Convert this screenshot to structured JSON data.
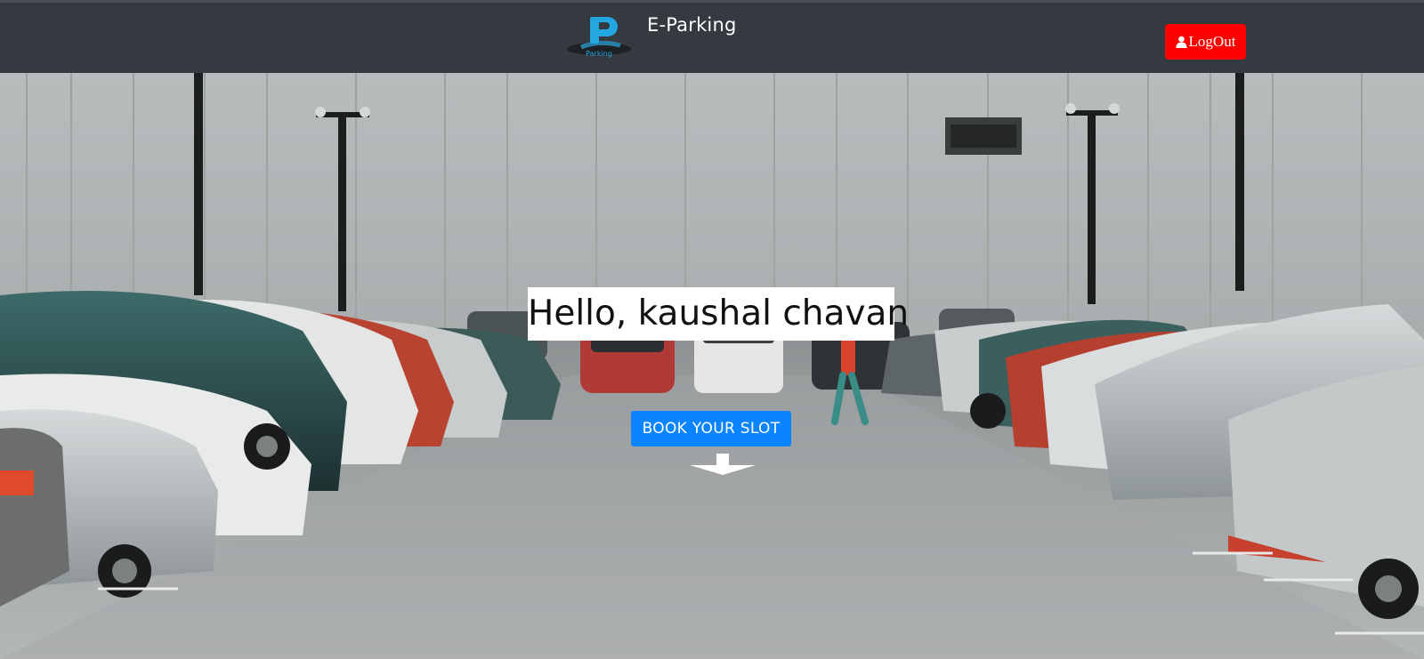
{
  "navbar": {
    "brand_name": "E-Parking",
    "logo_subtext": "Parking",
    "logout_label": "LogOut",
    "logout_icon": "user-icon",
    "colors": {
      "background": "#343a40",
      "logout": "#ff0000"
    }
  },
  "hero": {
    "greeting": "Hello, kaushal chavan",
    "book_button_label": "BOOK YOUR SLOT",
    "scroll_icon": "arrow-down-icon",
    "colors": {
      "book_button": "#0a84ff"
    }
  }
}
